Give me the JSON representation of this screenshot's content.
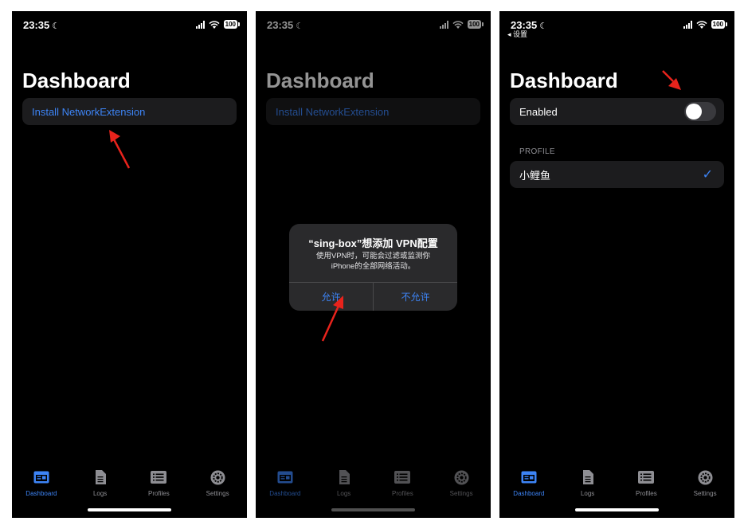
{
  "colors": {
    "accent": "#3d84f6",
    "background": "#000000",
    "row_background": "#1c1c1e",
    "annotation_arrow": "#e8231c"
  },
  "status": {
    "time": "23:35",
    "battery": "100",
    "back_label": "◂ 设置"
  },
  "dashboard": {
    "title": "Dashboard",
    "install_label": "Install NetworkExtension",
    "enabled_label": "Enabled",
    "enabled_on": false,
    "profile_header": "PROFILE",
    "profile_name": "小鲤鱼",
    "profile_selected": true
  },
  "alert": {
    "title": "“sing-box”想添加 VPN配置",
    "message_line1": "使用VPN时，可能会过滤或监测你",
    "message_line2": "iPhone的全部网络活动。",
    "allow_label": "允许",
    "deny_label": "不允许"
  },
  "tabs": [
    {
      "label": "Dashboard",
      "icon": "dashboard-icon"
    },
    {
      "label": "Logs",
      "icon": "document-icon"
    },
    {
      "label": "Profiles",
      "icon": "list-icon"
    },
    {
      "label": "Settings",
      "icon": "gear-icon"
    }
  ]
}
